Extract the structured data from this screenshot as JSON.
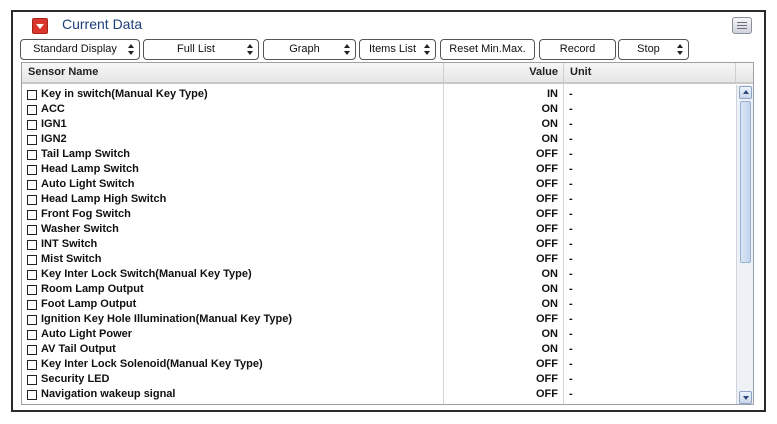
{
  "panel": {
    "title": "Current Data",
    "collapse_icon": "collapse-arrow-icon",
    "corner_icon": "panel-menu-icon"
  },
  "toolbar": {
    "buttons": [
      {
        "label": "Standard Display",
        "spinner": true
      },
      {
        "label": "Full List",
        "spinner": true
      },
      {
        "label": "Graph",
        "spinner": true
      },
      {
        "label": "Items List",
        "spinner": true
      },
      {
        "label": "Reset Min.Max.",
        "spinner": false
      },
      {
        "label": "Record",
        "spinner": false
      },
      {
        "label": "Stop",
        "spinner": true
      }
    ]
  },
  "table": {
    "headers": {
      "name": "Sensor Name",
      "value": "Value",
      "unit": "Unit"
    },
    "rows": [
      {
        "name": "Key in switch(Manual Key Type)",
        "value": "IN",
        "unit": "-"
      },
      {
        "name": "ACC",
        "value": "ON",
        "unit": "-"
      },
      {
        "name": "IGN1",
        "value": "ON",
        "unit": "-"
      },
      {
        "name": "IGN2",
        "value": "ON",
        "unit": "-"
      },
      {
        "name": "Tail Lamp Switch",
        "value": "OFF",
        "unit": "-"
      },
      {
        "name": "Head Lamp Switch",
        "value": "OFF",
        "unit": "-"
      },
      {
        "name": "Auto Light Switch",
        "value": "OFF",
        "unit": "-"
      },
      {
        "name": "Head Lamp High Switch",
        "value": "OFF",
        "unit": "-"
      },
      {
        "name": "Front Fog Switch",
        "value": "OFF",
        "unit": "-"
      },
      {
        "name": "Washer Switch",
        "value": "OFF",
        "unit": "-"
      },
      {
        "name": "INT Switch",
        "value": "OFF",
        "unit": "-"
      },
      {
        "name": "Mist Switch",
        "value": "OFF",
        "unit": "-"
      },
      {
        "name": "Key Inter Lock Switch(Manual Key Type)",
        "value": "ON",
        "unit": "-"
      },
      {
        "name": "Room Lamp Output",
        "value": "ON",
        "unit": "-"
      },
      {
        "name": "Foot Lamp Output",
        "value": "ON",
        "unit": "-"
      },
      {
        "name": "Ignition Key Hole Illumination(Manual Key Type)",
        "value": "OFF",
        "unit": "-"
      },
      {
        "name": "Auto Light Power",
        "value": "ON",
        "unit": "-"
      },
      {
        "name": "AV Tail Output",
        "value": "ON",
        "unit": "-"
      },
      {
        "name": "Key Inter Lock Solenoid(Manual Key Type)",
        "value": "OFF",
        "unit": "-"
      },
      {
        "name": "Security LED",
        "value": "OFF",
        "unit": "-"
      },
      {
        "name": "Navigation wakeup signal",
        "value": "OFF",
        "unit": "-"
      }
    ]
  },
  "scrollbar": {
    "up_icon": "scroll-up-arrow-icon",
    "down_icon": "scroll-down-arrow-icon"
  }
}
